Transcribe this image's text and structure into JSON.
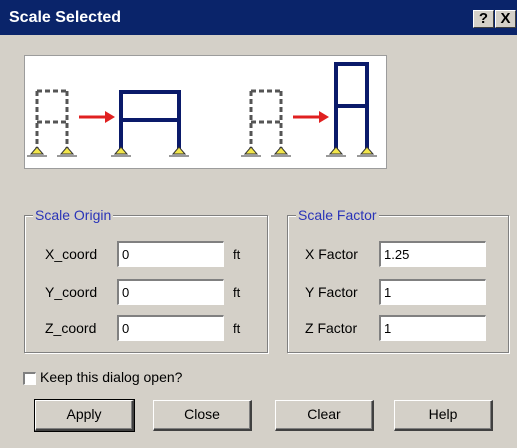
{
  "window": {
    "title": "Scale Selected",
    "help_button": "?",
    "close_button": "X"
  },
  "preview": {
    "dashed_color": "#555555",
    "frame_color": "#0a1a6a",
    "arrow_color": "#e02020",
    "support_color": "#f2e64a"
  },
  "scale_origin": {
    "legend": "Scale Origin",
    "fields": [
      {
        "label": "X_coord",
        "value": "0",
        "unit": "ft"
      },
      {
        "label": "Y_coord",
        "value": "0",
        "unit": "ft"
      },
      {
        "label": "Z_coord",
        "value": "0",
        "unit": "ft"
      }
    ]
  },
  "scale_factor": {
    "legend": "Scale Factor",
    "fields": [
      {
        "label": "X Factor",
        "value": "1.25"
      },
      {
        "label": "Y Factor",
        "value": "1"
      },
      {
        "label": "Z Factor",
        "value": "1"
      }
    ]
  },
  "keep_open": {
    "label": "Keep this dialog open?",
    "checked": false
  },
  "buttons": {
    "apply": "Apply",
    "close": "Close",
    "clear": "Clear",
    "help": "Help"
  },
  "accent_color": "#2a34b8",
  "titlebar_color": "#0a246a"
}
